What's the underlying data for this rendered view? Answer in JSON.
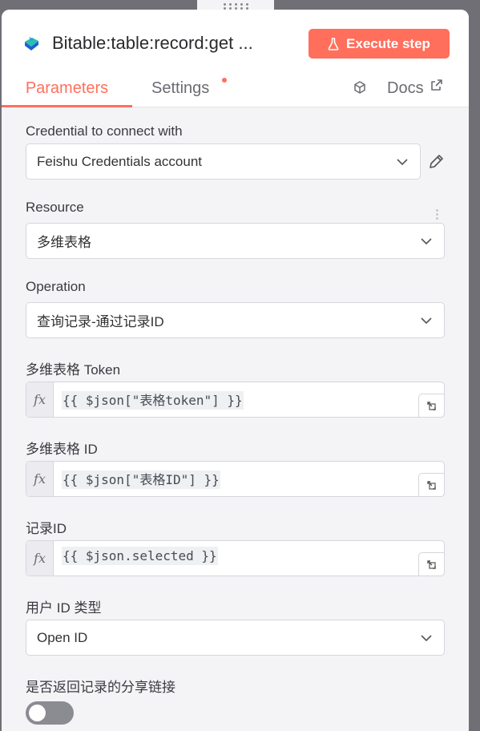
{
  "header": {
    "node_title": "Bitable:table:record:get ...",
    "execute_label": "Execute step"
  },
  "tabs": {
    "parameters": "Parameters",
    "settings": "Settings",
    "docs": "Docs"
  },
  "fields": {
    "credential": {
      "label": "Credential to connect with",
      "value": "Feishu Credentials account"
    },
    "resource": {
      "label": "Resource",
      "value": "多维表格"
    },
    "operation": {
      "label": "Operation",
      "value": "查询记录-通过记录ID"
    },
    "bitable_token": {
      "label": "多维表格 Token",
      "value": "{{ $json[\"表格token\"] }}"
    },
    "bitable_id": {
      "label": "多维表格 ID",
      "value": "{{ $json[\"表格ID\"] }}"
    },
    "record_id": {
      "label": "记录ID",
      "value": "{{ $json.selected }}"
    },
    "user_id_type": {
      "label": "用户 ID 类型",
      "value": "Open ID"
    },
    "return_share_link": {
      "label": "是否返回记录的分享链接",
      "value": false
    }
  },
  "fx_label": "fx",
  "colors": {
    "accent": "#ff6f5c",
    "toggle_off": "#8b8b92"
  }
}
